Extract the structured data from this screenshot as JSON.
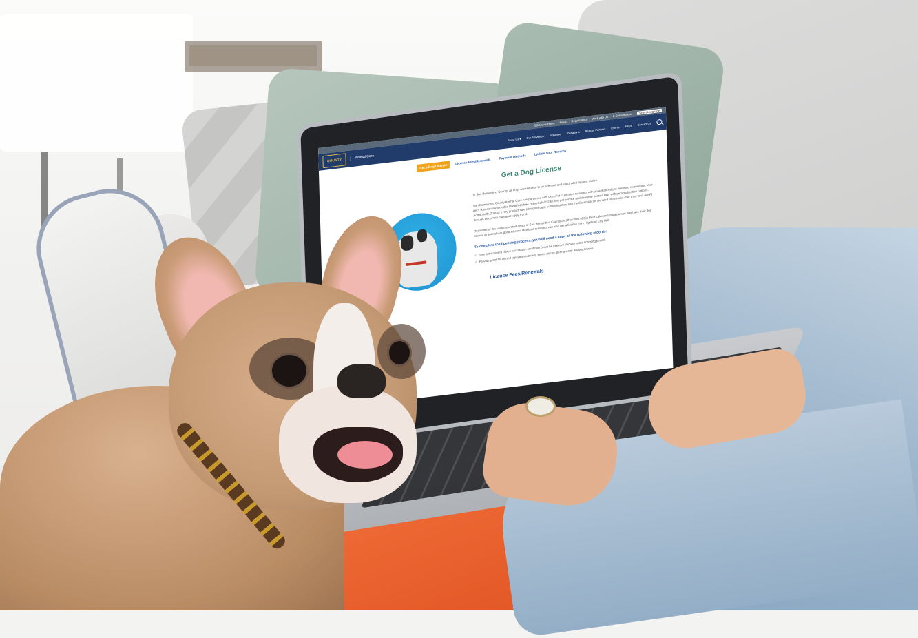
{
  "scene": {
    "description_tag": "stock-photo"
  },
  "website": {
    "topbar": {
      "items": [
        "SBCounty Home",
        "News",
        "Departments",
        "Work with Us",
        "E-Subscriptions"
      ],
      "language": "Select Language"
    },
    "brand": {
      "logo_text": "COUNTY",
      "site_name": "Animal Care"
    },
    "nav": {
      "items": [
        "About Us ▾",
        "Our Services ▾",
        "Volunteer",
        "Donations",
        "Rescue Partners",
        "Events",
        "FAQs",
        "Contact Us"
      ]
    },
    "tabs": [
      {
        "label": "Get a Dog License",
        "active": true
      },
      {
        "label": "License Fees/Renewals",
        "active": false
      },
      {
        "label": "Payment Methods",
        "active": false
      },
      {
        "label": "Update Your Records",
        "active": false
      }
    ],
    "page_title": "Get a Dog License",
    "paragraphs": [
      "In San Bernardino County, all dogs are required to be licensed and vaccinated against rabies.",
      "San Bernardino County Animal Care has partnered with DocuPet to provide residents with an enhanced pet licensing experience. Your pet's license now includes DocuPet's free HomeSafe™ 24/7 lost pet service and designer license tags with personalization options. Additionally, 20% of every product sale (designer tags, collars/leashes and the Essentials) is donated to Animals after third fund (ANF) through DocuPet's SafeandHappy Fund.",
      "Residents of the unincorporated areas of San Bernardino County and the cities of Big Bear Lake and Yucaipa can purchase their dog license at animalcare.docupet.com. Highland residents can also get a license from Highland City Hall."
    ],
    "link_text": "animalcare.docupet.com",
    "requirements_title": "To complete the licensing process, you will need a copy of the following records:",
    "requirements": [
      "Your pet's current rabies vaccination certificate (must be effective through entire licensing period).",
      "Provide proof for altered (spayed/neutered), senior citizen, permanently disabled status."
    ],
    "fees_link": "License Fees/Renewals"
  },
  "colors": {
    "nav_blue": "#213c6b",
    "accent_orange": "#f2a31c",
    "title_green": "#3f8a78",
    "link_blue": "#2a5ca7"
  }
}
